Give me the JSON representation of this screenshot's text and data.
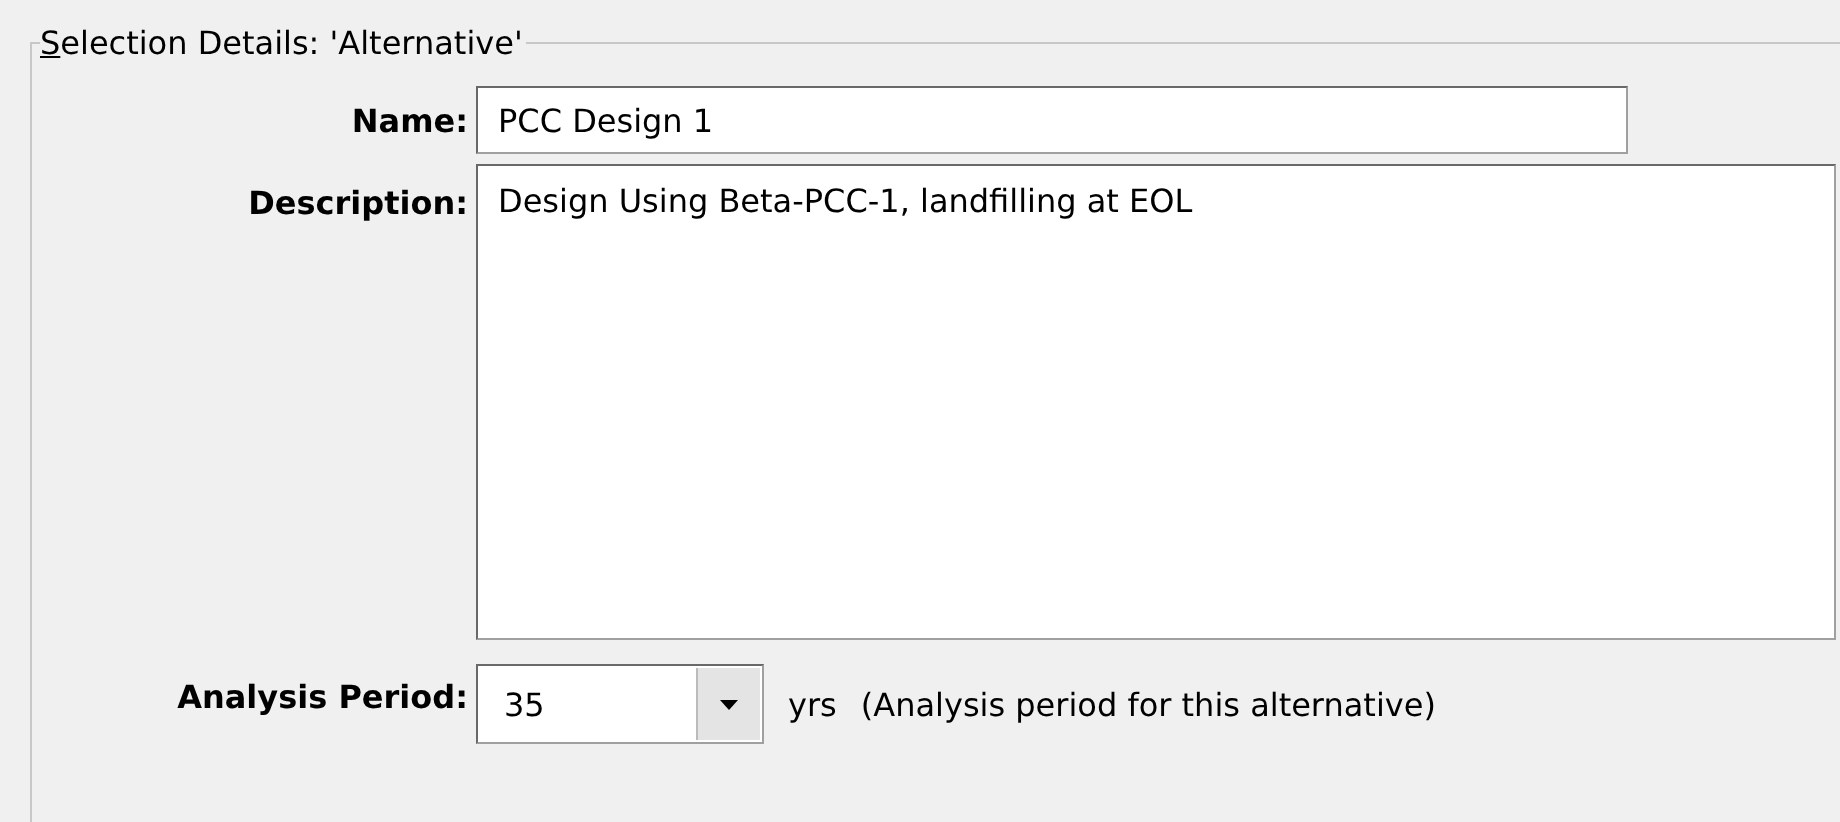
{
  "group": {
    "title": "Selection Details: 'Alternative'"
  },
  "name": {
    "label": "Name:",
    "value": "PCC Design 1"
  },
  "description": {
    "label": "Description:",
    "value": "Design Using Beta-PCC-1, landfilling at EOL"
  },
  "analysis_period": {
    "label": "Analysis Period:",
    "value": "35",
    "unit": "yrs",
    "note": "(Analysis period for this alternative)"
  }
}
